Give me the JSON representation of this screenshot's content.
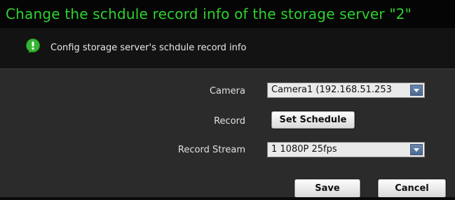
{
  "header": {
    "title": "Change the schdule record info of the storage server \"2\""
  },
  "info": {
    "icon": "info-bubble-icon",
    "text": "Config storage server's schdule record info"
  },
  "form": {
    "camera_label": "Camera",
    "camera_value": "Camera1 (192.168.51.253",
    "record_label": "Record",
    "set_schedule_label": "Set Schedule",
    "stream_label": "Record Stream",
    "stream_value": "1 1080P 25fps"
  },
  "actions": {
    "save_label": "Save",
    "cancel_label": "Cancel"
  },
  "colors": {
    "title": "#2fd12f",
    "background": "#2b2b2b",
    "icon_green": "#35b535"
  }
}
